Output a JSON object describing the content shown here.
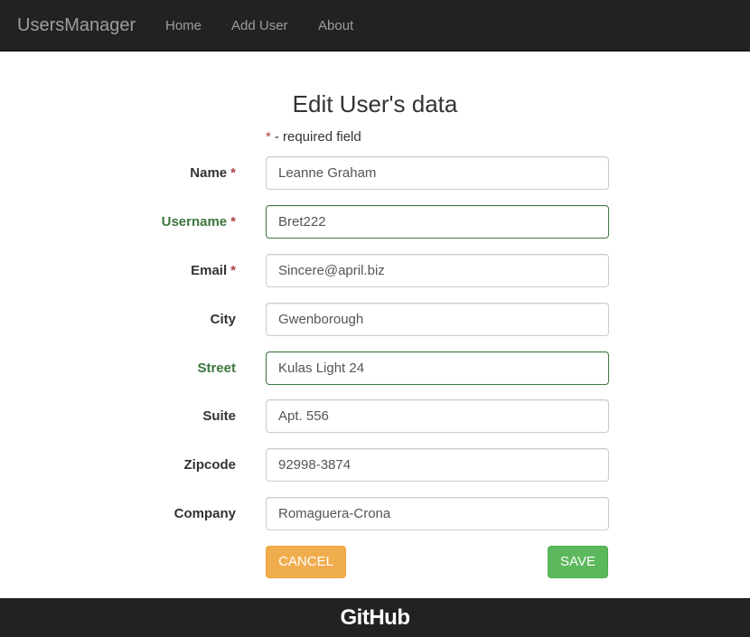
{
  "navbar": {
    "brand": "UsersManager",
    "links": [
      "Home",
      "Add User",
      "About"
    ]
  },
  "page": {
    "title": "Edit User's data",
    "required_star": "*",
    "required_note": "- required field"
  },
  "form": {
    "required_mark": "*",
    "fields": [
      {
        "label": "Name",
        "value": "Leanne Graham",
        "required": true,
        "state": "default"
      },
      {
        "label": "Username",
        "value": "Bret222",
        "required": true,
        "state": "valid"
      },
      {
        "label": "Email",
        "value": "Sincere@april.biz",
        "required": true,
        "state": "default"
      },
      {
        "label": "City",
        "value": "Gwenborough",
        "required": false,
        "state": "default"
      },
      {
        "label": "Street",
        "value": "Kulas Light 24",
        "required": false,
        "state": "valid"
      },
      {
        "label": "Suite",
        "value": "Apt. 556",
        "required": false,
        "state": "default"
      },
      {
        "label": "Zipcode",
        "value": "92998-3874",
        "required": false,
        "state": "default"
      },
      {
        "label": "Company",
        "value": "Romaguera-Crona",
        "required": false,
        "state": "default"
      }
    ],
    "cancel_label": "CANCEL",
    "save_label": "SAVE"
  },
  "footer": {
    "logo_text": "GitHub"
  },
  "colors": {
    "navbar_bg": "#222222",
    "nav_text": "#9d9d9d",
    "required_star": "#a94442",
    "valid_green": "#3c763d",
    "cancel_btn": "#f0ad4e",
    "save_btn": "#5cb85c"
  }
}
